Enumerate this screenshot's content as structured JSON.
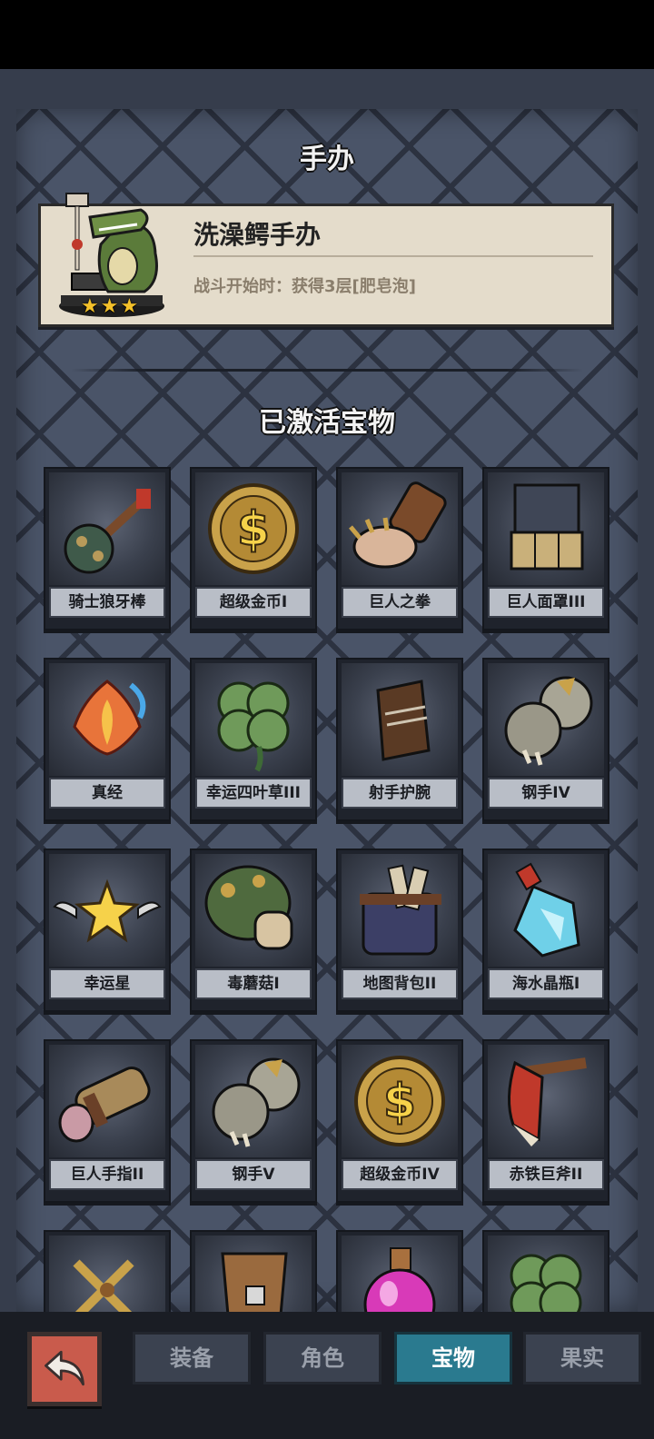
{
  "figure_section": {
    "title": "手办",
    "figure_name": "洗澡鳄手办",
    "figure_desc": "战斗开始时：获得3层[肥皂泡]",
    "stars": 3,
    "star_glyph": "★"
  },
  "treasure_section": {
    "title": "已激活宝物",
    "items": [
      {
        "label": "骑士狼牙棒",
        "icon": "mace-icon"
      },
      {
        "label": "超级金币I",
        "icon": "gold-coin-icon"
      },
      {
        "label": "巨人之拳",
        "icon": "giant-fist-icon"
      },
      {
        "label": "巨人面罩III",
        "icon": "giant-mask-icon"
      },
      {
        "label": "真经",
        "icon": "flame-lotus-icon"
      },
      {
        "label": "幸运四叶草III",
        "icon": "four-leaf-clover-icon"
      },
      {
        "label": "射手护腕",
        "icon": "archer-bracer-icon"
      },
      {
        "label": "钢手IV",
        "icon": "steel-gauntlet-icon"
      },
      {
        "label": "幸运星",
        "icon": "winged-star-icon"
      },
      {
        "label": "毒蘑菇I",
        "icon": "poison-mushroom-icon"
      },
      {
        "label": "地图背包II",
        "icon": "map-backpack-icon"
      },
      {
        "label": "海水晶瓶I",
        "icon": "sea-crystal-bottle-icon"
      },
      {
        "label": "巨人手指II",
        "icon": "giant-finger-icon"
      },
      {
        "label": "钢手V",
        "icon": "steel-gauntlet-icon"
      },
      {
        "label": "超级金币IV",
        "icon": "gold-coin-icon"
      },
      {
        "label": "赤铁巨斧II",
        "icon": "red-axe-icon"
      },
      {
        "label": "",
        "icon": "golden-scissors-icon"
      },
      {
        "label": "",
        "icon": "wooden-shield-icon"
      },
      {
        "label": "",
        "icon": "pink-potion-icon"
      },
      {
        "label": "",
        "icon": "four-leaf-clover-icon"
      }
    ]
  },
  "tabs": {
    "equipment": "装备",
    "character": "角色",
    "treasure": "宝物",
    "fruit": "果实",
    "active": "宝物"
  }
}
